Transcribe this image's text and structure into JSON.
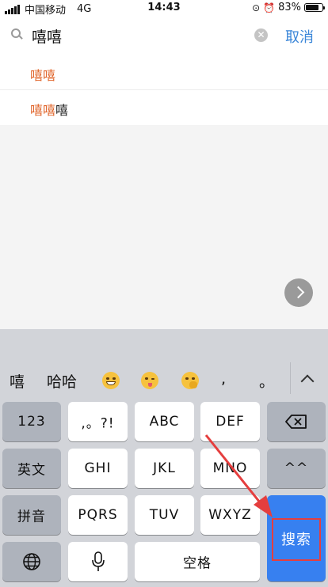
{
  "status_bar": {
    "carrier": "中国移动",
    "network": "4G",
    "time": "14:43",
    "battery": "83%",
    "battery_level": 0.83
  },
  "search": {
    "query": "嘻嘻",
    "cancel_label": "取消"
  },
  "suggestions": [
    {
      "highlight": "嘻嘻",
      "rest": ""
    },
    {
      "highlight": "嘻嘻",
      "rest": "嘻"
    }
  ],
  "keyboard": {
    "candidates": [
      "嘻",
      "哈哈"
    ],
    "emojis": [
      "grinning-face-icon",
      "winking-tongue-face-icon",
      "hand-over-mouth-face-icon"
    ],
    "punct": [
      ",",
      "。"
    ],
    "rows": {
      "r1": [
        "123",
        ",。?!",
        "ABC",
        "DEF"
      ],
      "r2": [
        "英文",
        "GHI",
        "JKL",
        "MNO",
        "^^"
      ],
      "r3": [
        "拼音",
        "PQRS",
        "TUV",
        "WXYZ"
      ],
      "r4_space": "空格",
      "search": "搜索"
    },
    "accent_color": "#3780f0"
  }
}
